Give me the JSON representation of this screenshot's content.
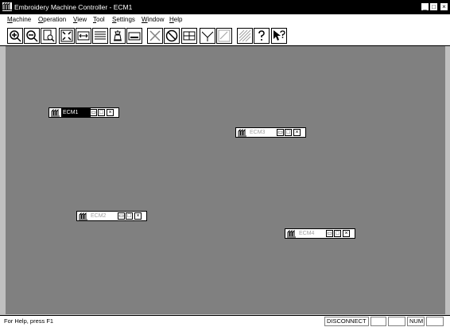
{
  "window": {
    "title": "Embroidery Machine Controller - ECM1"
  },
  "title_buttons": {
    "minimize": "_",
    "maximize": "□",
    "close": "×"
  },
  "menu": [
    {
      "label": "Machine",
      "key": "M",
      "rest": "achine"
    },
    {
      "label": "Operation",
      "key": "O",
      "rest": "peration"
    },
    {
      "label": "View",
      "key": "V",
      "rest": "iew"
    },
    {
      "label": "Tool",
      "key": "T",
      "rest": "ool"
    },
    {
      "label": "Settings",
      "key": "S",
      "rest": "ettings"
    },
    {
      "label": "Window",
      "key": "W",
      "rest": "indow"
    },
    {
      "label": "Help",
      "key": "H",
      "rest": "elp"
    }
  ],
  "toolbar": [
    {
      "name": "zoom-in-icon"
    },
    {
      "name": "zoom-out-icon"
    },
    {
      "name": "zoom-page-icon"
    },
    {
      "name": "fit-window-icon"
    },
    {
      "name": "fit-width-icon"
    },
    {
      "name": "design-list-icon"
    },
    {
      "name": "bobbin-icon"
    },
    {
      "name": "machine-panel-icon"
    },
    {
      "name": "cross-icon"
    },
    {
      "name": "stop-icon"
    },
    {
      "name": "split-view-icon"
    },
    {
      "name": "frame-icon"
    },
    {
      "name": "disabled-frame-icon"
    },
    {
      "name": "disabled-hatch-icon"
    },
    {
      "name": "help-icon"
    },
    {
      "name": "context-help-icon"
    }
  ],
  "children": [
    {
      "title": "ECM1",
      "active": true
    },
    {
      "title": "ECM3",
      "active": false
    },
    {
      "title": "ECM2",
      "active": false
    },
    {
      "title": "ECM4",
      "active": false
    }
  ],
  "status": {
    "help": "For Help, press F1",
    "connection": "DISCONNECT",
    "num": "NUM"
  }
}
